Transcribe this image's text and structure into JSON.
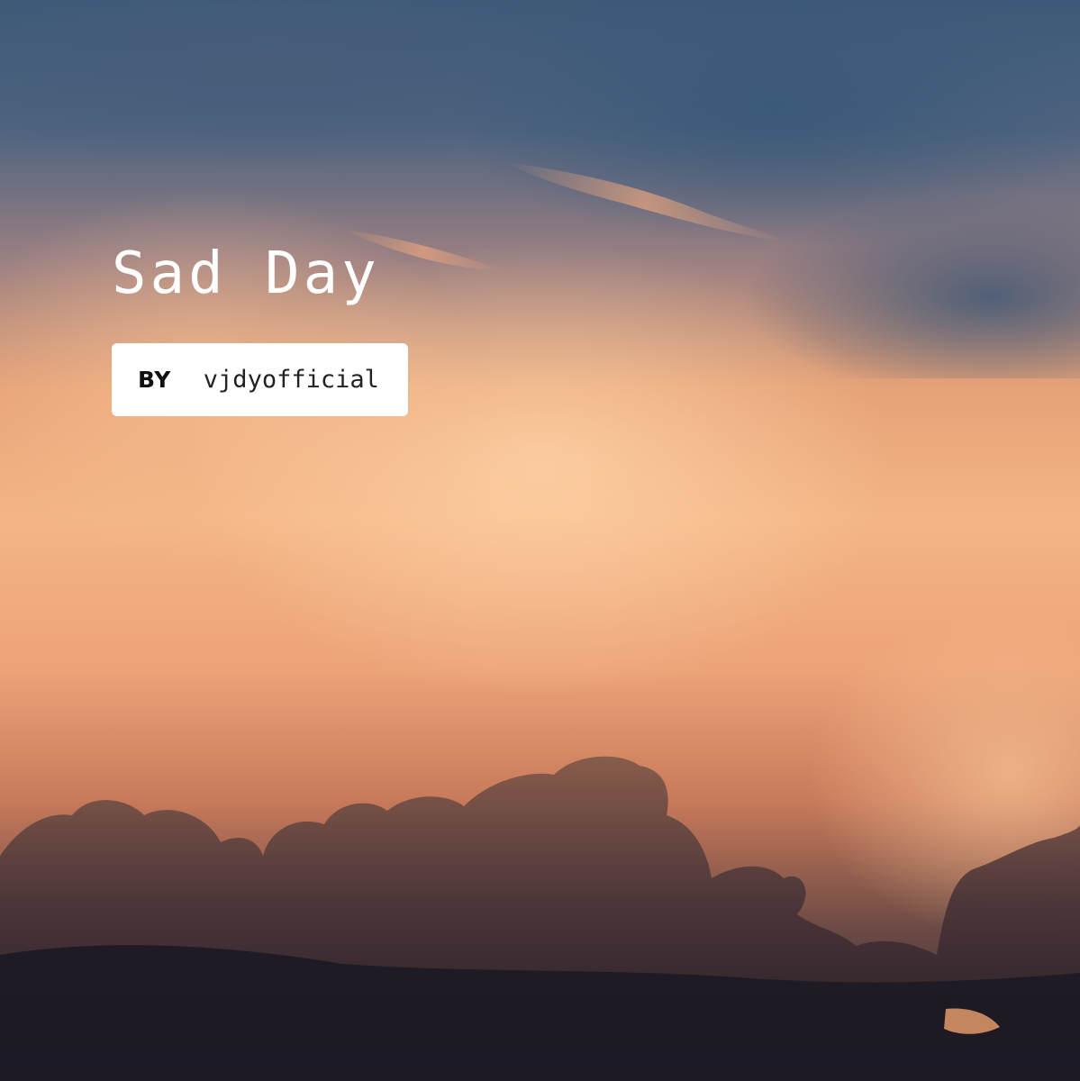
{
  "cover": {
    "title": "Sad Day",
    "credit_prefix": "BY",
    "author": "vjdyofficial"
  },
  "colors": {
    "sky_blue": "#4e6480",
    "cloud_glow": "#f4b585",
    "dark_cloud": "#2d2430",
    "title_text": "#ffffff",
    "credit_bg": "#ffffff",
    "credit_text": "#111111"
  }
}
